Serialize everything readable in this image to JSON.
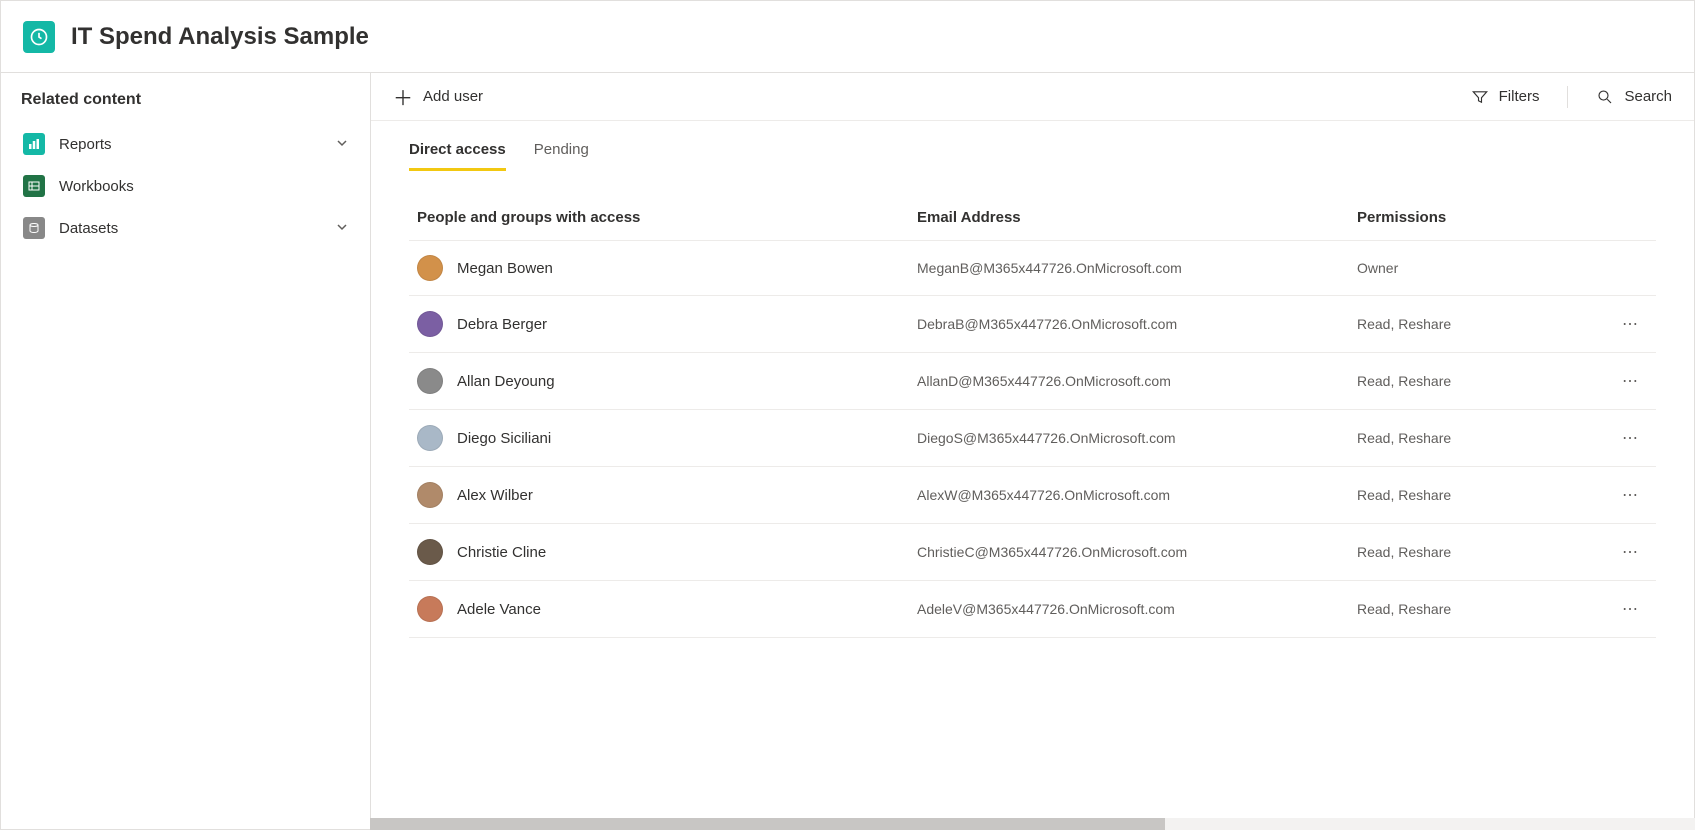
{
  "header": {
    "title": "IT Spend Analysis Sample"
  },
  "sidebar": {
    "heading": "Related content",
    "items": [
      {
        "label": "Reports",
        "expandable": true
      },
      {
        "label": "Workbooks",
        "expandable": false
      },
      {
        "label": "Datasets",
        "expandable": true
      }
    ]
  },
  "toolbar": {
    "add_user": "Add user",
    "filters": "Filters",
    "search": "Search"
  },
  "tabs": {
    "direct_access": "Direct access",
    "pending": "Pending"
  },
  "table": {
    "headers": {
      "people": "People and groups with access",
      "email": "Email Address",
      "permissions": "Permissions"
    },
    "rows": [
      {
        "name": "Megan Bowen",
        "email": "MeganB@M365x447726.OnMicrosoft.com",
        "permission": "Owner",
        "has_more": false,
        "avatar": "#d2914a"
      },
      {
        "name": "Debra Berger",
        "email": "DebraB@M365x447726.OnMicrosoft.com",
        "permission": "Read, Reshare",
        "has_more": true,
        "avatar": "#7b5fa3"
      },
      {
        "name": "Allan Deyoung",
        "email": "AllanD@M365x447726.OnMicrosoft.com",
        "permission": "Read, Reshare",
        "has_more": true,
        "avatar": "#8a8a8a"
      },
      {
        "name": "Diego Siciliani",
        "email": "DiegoS@M365x447726.OnMicrosoft.com",
        "permission": "Read, Reshare",
        "has_more": true,
        "avatar": "#a9b8c7"
      },
      {
        "name": "Alex Wilber",
        "email": "AlexW@M365x447726.OnMicrosoft.com",
        "permission": "Read, Reshare",
        "has_more": true,
        "avatar": "#b08a6a"
      },
      {
        "name": "Christie Cline",
        "email": "ChristieC@M365x447726.OnMicrosoft.com",
        "permission": "Read, Reshare",
        "has_more": true,
        "avatar": "#6a5a4a"
      },
      {
        "name": "Adele Vance",
        "email": "AdeleV@M365x447726.OnMicrosoft.com",
        "permission": "Read, Reshare",
        "has_more": true,
        "avatar": "#c77a5a"
      }
    ]
  }
}
